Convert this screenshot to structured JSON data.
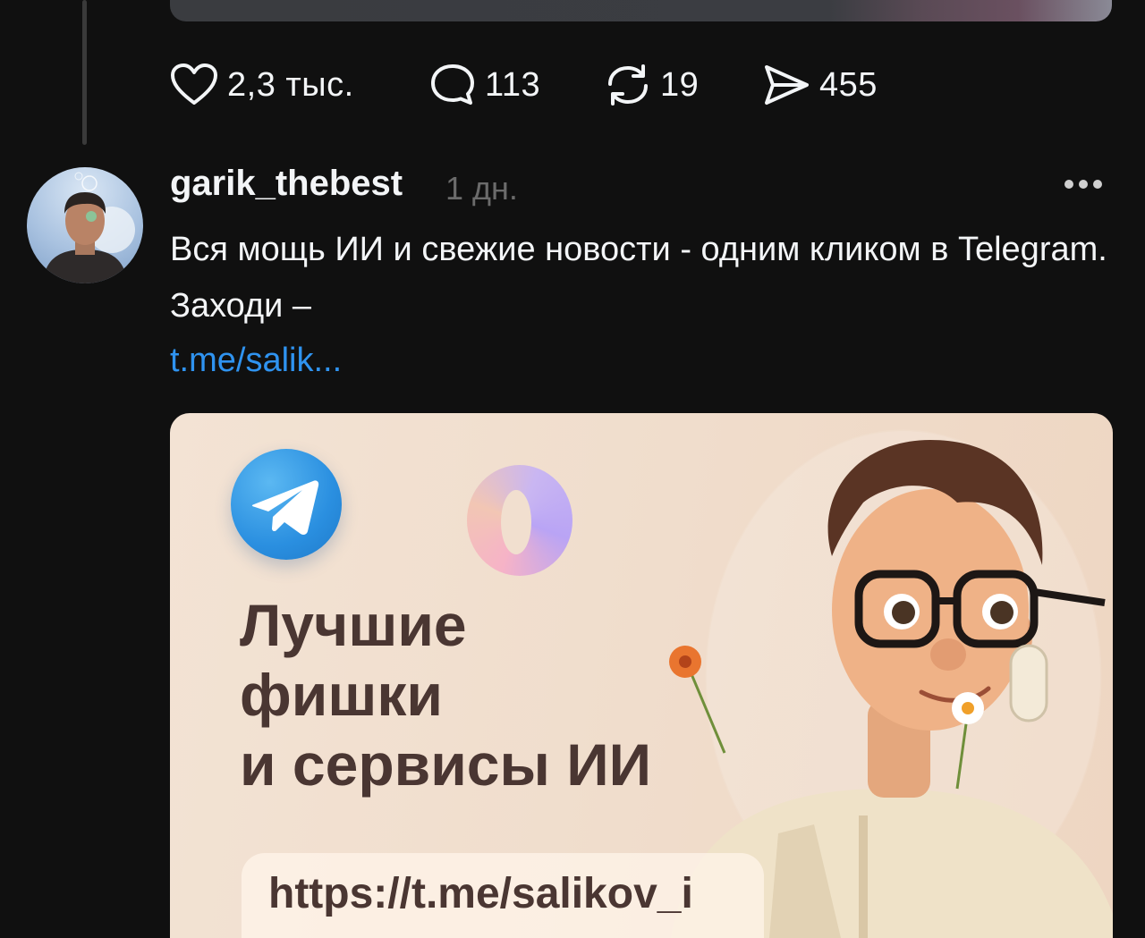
{
  "previous_post": {
    "actions": {
      "likes": "2,3 тыс.",
      "replies": "113",
      "reposts": "19",
      "shares": "455"
    }
  },
  "post": {
    "username": "garik_thebest",
    "timestamp": "1 дн.",
    "text": "Вся мощь ИИ и свежие новости - одним кликом в Telegram. Заходи –",
    "link": "t.me/salik...",
    "image": {
      "headline_lines": [
        "Лучшие",
        "фишки",
        "и сервисы ИИ"
      ],
      "url": "https://t.me/salikov_i"
    }
  },
  "icons": [
    "heart-icon",
    "comment-icon",
    "repost-icon",
    "send-icon",
    "more-icon",
    "telegram-logo-icon"
  ],
  "colors": {
    "background": "#101010",
    "text": "#f3f5f7",
    "muted": "#6b6b6b",
    "link": "#2f93f0"
  }
}
